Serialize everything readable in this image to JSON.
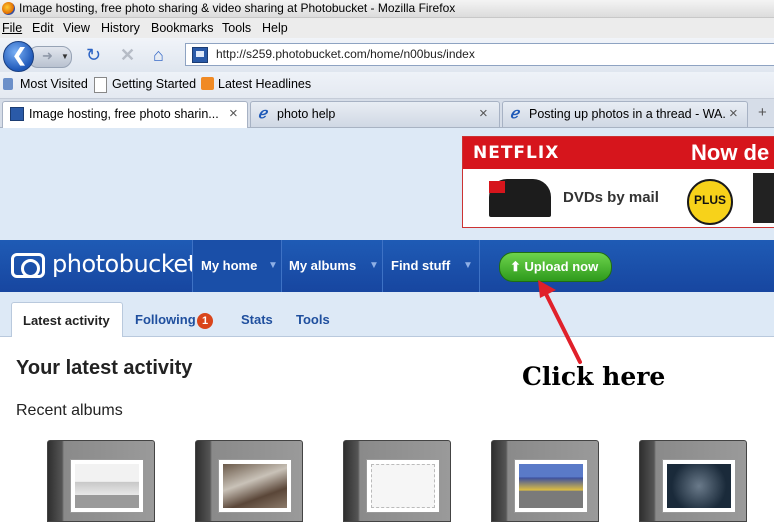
{
  "window": {
    "title": "Image hosting, free photo sharing & video sharing at Photobucket - Mozilla Firefox"
  },
  "menu": {
    "items": [
      "File",
      "Edit",
      "View",
      "History",
      "Bookmarks",
      "Tools",
      "Help"
    ]
  },
  "navigation": {
    "url": "http://s259.photobucket.com/home/n00bus/index"
  },
  "bookmarks": {
    "items": [
      "Most Visited",
      "Getting Started",
      "Latest Headlines"
    ]
  },
  "tabs": [
    {
      "label": "Image hosting, free photo sharin...",
      "active": true
    },
    {
      "label": "photo help",
      "active": false
    },
    {
      "label": "Posting up photos in a thread - WA...",
      "active": false
    }
  ],
  "ad": {
    "brand": "NETFLIX",
    "headline": "Now de",
    "tagline": "DVDs by mail",
    "badge": "PLUS"
  },
  "photobucket": {
    "logo": "photobucket",
    "nav": [
      "My home",
      "My albums",
      "Find stuff"
    ],
    "upload_label": "Upload now",
    "subtabs": [
      "Latest activity",
      "Following",
      "Stats",
      "Tools"
    ],
    "following_count": "1",
    "latest_title": "Your latest activity",
    "recent_albums_title": "Recent albums",
    "albums_count": 5
  },
  "annotation": {
    "text": "Click here",
    "color": "#e0202a"
  },
  "colors": {
    "pb_blue": "#1f5bb5",
    "upload_green": "#3aa824",
    "netflix_red": "#d6151c"
  }
}
